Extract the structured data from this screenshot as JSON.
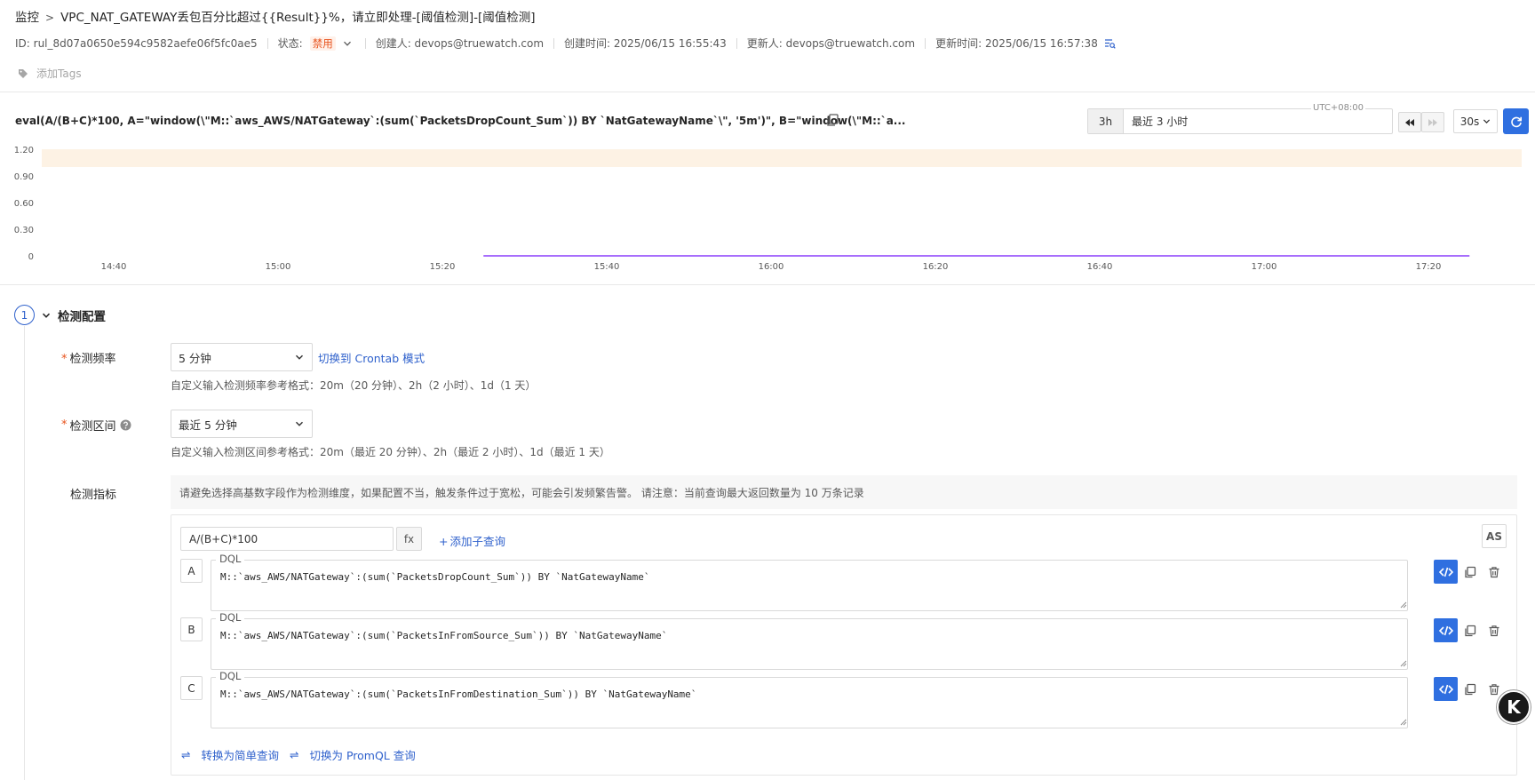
{
  "header": {
    "breadcrumb_root": "监控",
    "title": "VPC_NAT_GATEWAY丢包百分比超过{{Result}}%，请立即处理-[阈值检测]-[阈值检测]",
    "id_text": "ID: rul_8d07a0650e594c9582aefe06f5fc0ae5",
    "status_label": "状态:",
    "status_value": "禁用",
    "creator": "创建人: devops@truewatch.com",
    "created_at": "创建时间: 2025/06/15 16:55:43",
    "updater": "更新人: devops@truewatch.com",
    "updated_at": "更新时间: 2025/06/15 16:57:38",
    "add_tags": "添加Tags"
  },
  "query_bar": {
    "expression": "eval(A/(B+C)*100, A=\"window(\\\"M::`aws_AWS/NATGateway`:(sum(`PacketsDropCount_Sum`)) BY `NatGatewayName`\\\", '5m')\", B=\"window(\\\"M::`a...",
    "time_short": "3h",
    "time_range": "最近 3 小时",
    "timezone": "UTC+08:00",
    "refresh_interval": "30s"
  },
  "chart_data": {
    "type": "line",
    "x": [
      "14:40",
      "15:00",
      "15:20",
      "15:40",
      "16:00",
      "16:20",
      "16:40",
      "17:00",
      "17:20"
    ],
    "y_ticks": [
      "0",
      "0.30",
      "0.60",
      "0.90",
      "1.20"
    ],
    "ylim": [
      0,
      1.2
    ],
    "threshold_band": [
      1.0,
      1.2
    ],
    "threshold_color": "#fdf2e4",
    "series": [
      {
        "color": "#8a3ffc",
        "start": "15:25",
        "end": "17:25",
        "values": [
          0,
          0
        ]
      }
    ]
  },
  "detection": {
    "step_number": "1",
    "section_title": "检测配置",
    "frequency_label": "检测频率",
    "frequency_value": "5 分钟",
    "frequency_switch": "切换到 Crontab 模式",
    "frequency_hint": "自定义输入检测频率参考格式：20m（20 分钟）、2h（2 小时）、1d（1 天）",
    "interval_label": "检测区间",
    "interval_value": "最近 5 分钟",
    "interval_hint": "自定义输入检测区间参考格式：20m（最近 20 分钟）、2h（最近 2 小时）、1d（最近 1 天）",
    "metric_label": "检测指标",
    "metric_notice": "请避免选择高基数字段作为检测维度，如果配置不当，触发条件过于宽松，可能会引发频繁告警。 请注意：当前查询最大返回数量为 10 万条记录",
    "formula": "A/(B+C)*100",
    "fx_label": "fx",
    "add_subquery": "添加子查询",
    "as_label": "AS",
    "dql_tag": "DQL",
    "queries": [
      {
        "letter": "A",
        "dql": "M::`aws_AWS/NATGateway`:(sum(`PacketsDropCount_Sum`)) BY `NatGatewayName`"
      },
      {
        "letter": "B",
        "dql": "M::`aws_AWS/NATGateway`:(sum(`PacketsInFromSource_Sum`)) BY `NatGatewayName`"
      },
      {
        "letter": "C",
        "dql": "M::`aws_AWS/NATGateway`:(sum(`PacketsInFromDestination_Sum`)) BY `NatGatewayName`"
      }
    ],
    "to_simple": "转换为简单查询",
    "to_promql": "切换为 PromQL 查询"
  },
  "k_badge": "K"
}
